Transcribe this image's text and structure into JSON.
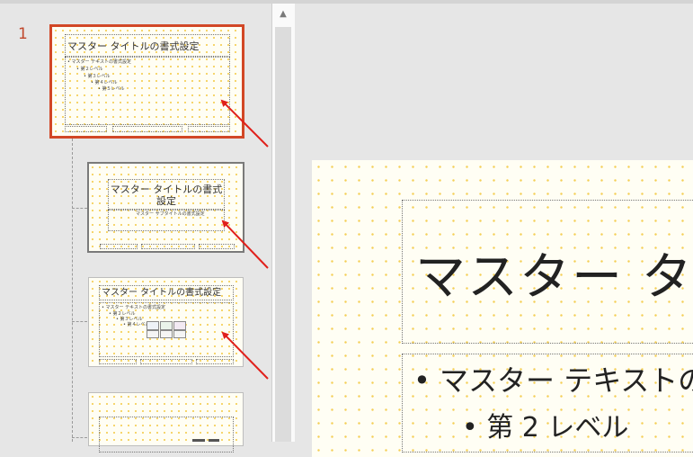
{
  "slide_panel": {
    "slide_number": "1",
    "thumbnails": [
      {
        "title": "マスター タイトルの書式設定",
        "body_lines": [
          "• マスター テキストの書式設定",
          "• 第２レベル",
          "• 第３レベル",
          "• 第４レベル",
          "• 第５レベル"
        ]
      },
      {
        "title_line1": "マスター タイトルの書式",
        "title_line2": "設定",
        "subtitle": "マスター サブタイトルの書式設定"
      },
      {
        "title": "マスター タイトルの書式設定",
        "body_lines": [
          "• マスター テキストの書式設定",
          "• 第２レベル",
          "• 第３レベル",
          "• 第４レベル"
        ]
      },
      {
        "title": ""
      }
    ]
  },
  "main_slide": {
    "title": "マスター タイトルの書式設定",
    "body_level1": "• マスター テキストの書式設定",
    "body_level2": "• 第 2 レベル"
  },
  "annotations": {
    "arrow_color": "#e0201b"
  },
  "colors": {
    "accent": "#d24726",
    "dot_pattern": "#f4cf57"
  }
}
